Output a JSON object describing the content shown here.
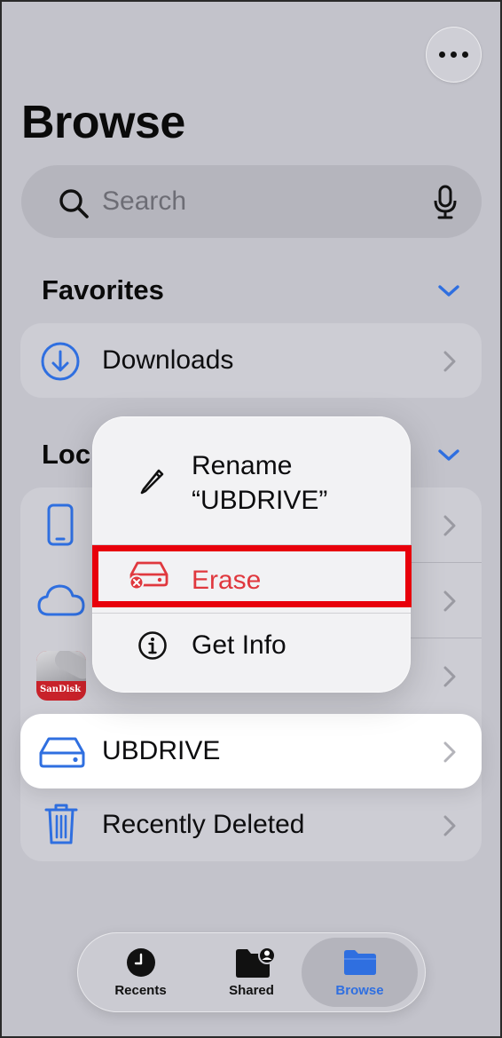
{
  "header": {
    "more_icon": "ellipsis-icon",
    "title": "Browse"
  },
  "search": {
    "placeholder": "Search",
    "icons": [
      "search-icon",
      "microphone-icon"
    ]
  },
  "favorites": {
    "title": "Favorites",
    "items": [
      {
        "label": "Downloads",
        "icon": "download-circle-icon"
      }
    ]
  },
  "locations": {
    "title": "Loc",
    "items": [
      {
        "label": "",
        "icon": "iphone-icon"
      },
      {
        "label": "",
        "icon": "icloud-icon"
      },
      {
        "label": "",
        "icon": "sandisk-app-icon"
      },
      {
        "label": "UBDRIVE",
        "icon": "external-drive-icon"
      },
      {
        "label": "Recently Deleted",
        "icon": "trash-icon"
      }
    ],
    "sandisk_logo_text": "SanDisk"
  },
  "context_menu": {
    "items": [
      {
        "line1": "Rename",
        "line2": "“UBDRIVE”",
        "icon": "pencil-icon"
      },
      {
        "label": "Erase",
        "icon": "erase-drive-icon",
        "color": "#e0383e"
      },
      {
        "label": "Get Info",
        "icon": "info-circle-icon"
      }
    ]
  },
  "tabbar": {
    "tabs": [
      {
        "label": "Recents",
        "icon": "clock-icon",
        "active": false
      },
      {
        "label": "Shared",
        "icon": "shared-folder-icon",
        "active": false
      },
      {
        "label": "Browse",
        "icon": "folder-icon",
        "active": true
      }
    ]
  },
  "colors": {
    "accent": "#2f6fe0",
    "destructive": "#e0383e",
    "highlight_box": "#e8000b"
  }
}
